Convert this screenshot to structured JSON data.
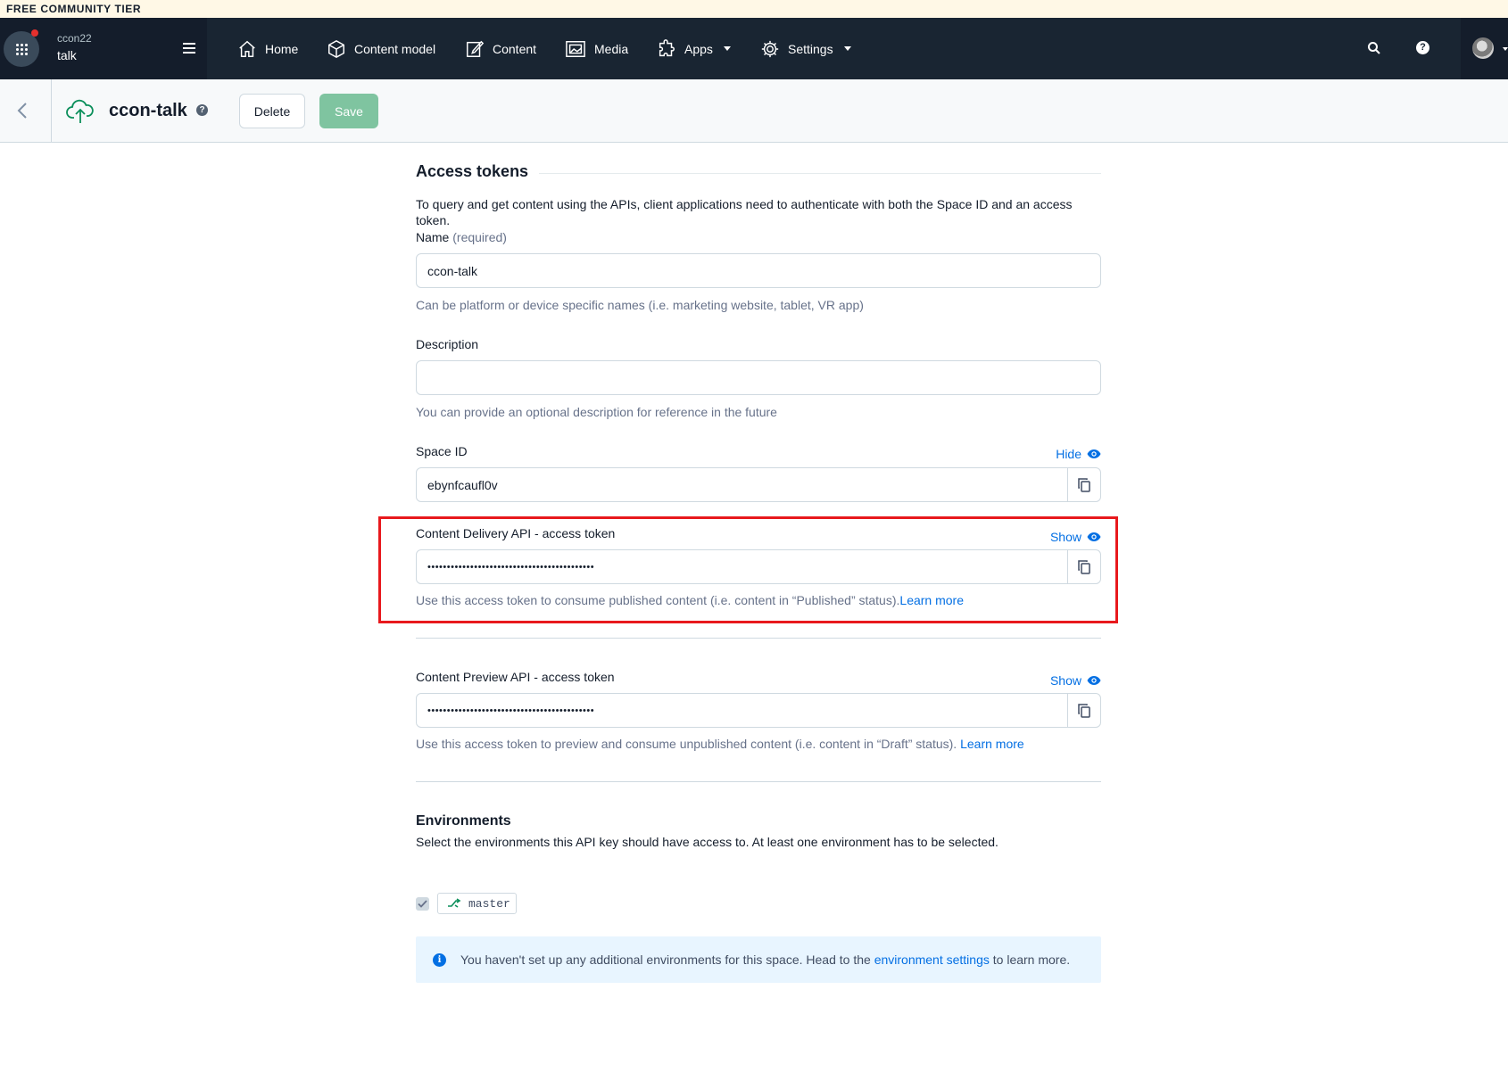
{
  "banner": {
    "text": "FREE COMMUNITY TIER"
  },
  "nav": {
    "space_org": "ccon22",
    "space_name": "talk",
    "items": [
      {
        "label": "Home",
        "icon": "home-icon"
      },
      {
        "label": "Content model",
        "icon": "cube-icon"
      },
      {
        "label": "Content",
        "icon": "edit-icon"
      },
      {
        "label": "Media",
        "icon": "image-icon"
      },
      {
        "label": "Apps",
        "icon": "puzzle-icon",
        "dropdown": true
      },
      {
        "label": "Settings",
        "icon": "gear-icon",
        "dropdown": true
      }
    ]
  },
  "header": {
    "title": "ccon-talk",
    "delete_label": "Delete",
    "save_label": "Save"
  },
  "access_tokens": {
    "heading": "Access tokens",
    "intro": "To query and get content using the APIs, client applications need to authenticate with both the Space ID and an access token.",
    "name": {
      "label": "Name",
      "required": "(required)",
      "value": "ccon-talk",
      "help": "Can be platform or device specific names (i.e. marketing website, tablet, VR app)"
    },
    "description": {
      "label": "Description",
      "value": "",
      "help": "You can provide an optional description for reference in the future"
    },
    "space_id": {
      "label": "Space ID",
      "toggle": "Hide",
      "value": "ebynfcaufl0v"
    },
    "cda_token": {
      "label": "Content Delivery API - access token",
      "toggle": "Show",
      "value": "•••••••••••••••••••••••••••••••••••••••••••",
      "help": "Use this access token to consume published content (i.e. content in “Published” status).",
      "link": "Learn more"
    },
    "cpa_token": {
      "label": "Content Preview API - access token",
      "toggle": "Show",
      "value": "•••••••••••••••••••••••••••••••••••••••••••",
      "help": "Use this access token to preview and consume unpublished content (i.e. content in “Draft” status). ",
      "link": "Learn more"
    }
  },
  "environments": {
    "heading": "Environments",
    "intro": "Select the environments this API key should have access to. At least one environment has to be selected.",
    "items": [
      {
        "name": "master",
        "checked": true
      }
    ],
    "note_before": "You haven't set up any additional environments for this space. Head to the ",
    "note_link": "environment settings",
    "note_after": " to learn more."
  },
  "colors": {
    "nav_bg": "#192532",
    "primary": "#036fe3",
    "save_disabled": "#7fc4a0",
    "highlight": "#e8191d"
  }
}
